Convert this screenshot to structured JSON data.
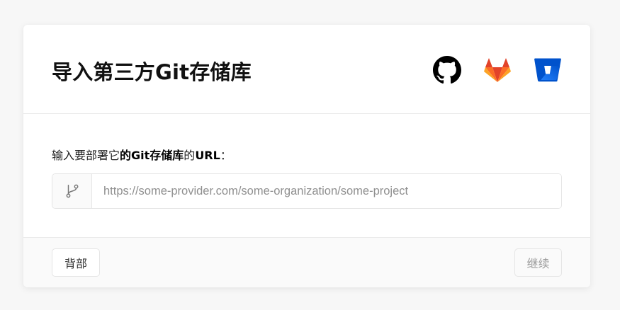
{
  "header": {
    "title": "导入第三方Git存储库",
    "providers": [
      {
        "name": "github-icon"
      },
      {
        "name": "gitlab-icon"
      },
      {
        "name": "bitbucket-icon"
      }
    ]
  },
  "body": {
    "label_prefix": "输入要部署它",
    "label_bold_1": "的Git存储库",
    "label_middle": "的",
    "label_bold_2": "URL",
    "label_suffix": "：",
    "url_input": {
      "value": "",
      "placeholder": "https://some-provider.com/some-organization/some-project",
      "icon": "git-branch-icon"
    }
  },
  "footer": {
    "back_label": "背部",
    "continue_label": "继续"
  },
  "colors": {
    "gitlab_orange": "#e24329",
    "gitlab_light": "#fca326",
    "bitbucket_blue": "#0052cc"
  }
}
